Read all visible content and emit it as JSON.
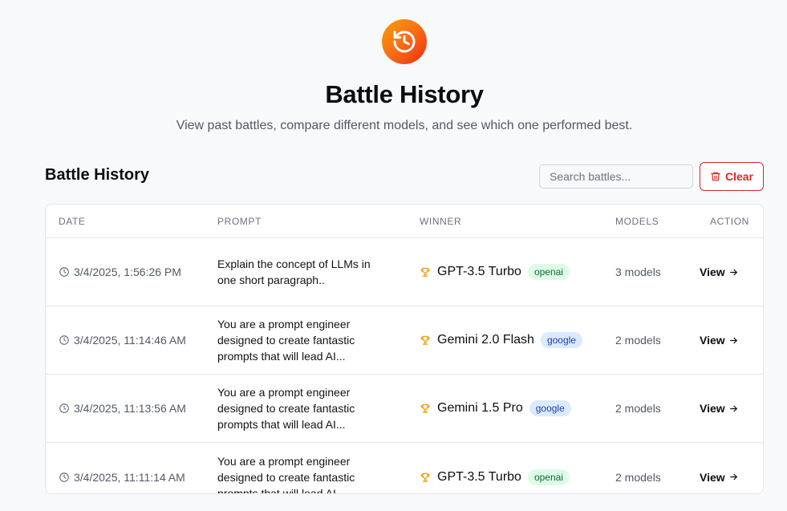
{
  "header": {
    "icon": "history-icon",
    "title": "Battle History",
    "subtitle": "View past battles, compare different models, and see which one performed best."
  },
  "section": {
    "title": "Battle History",
    "search_placeholder": "Search battles...",
    "clear_label": "Clear"
  },
  "table": {
    "columns": [
      "Date",
      "Prompt",
      "Winner",
      "Models",
      "Action"
    ],
    "rows": [
      {
        "date": "3/4/2025, 1:56:26 PM",
        "prompt_lines": [
          "Explain the concept of LLMs in",
          "one short paragraph.."
        ],
        "winner": "GPT-3.5 Turbo",
        "provider": "openai",
        "models": "3 models",
        "action": "View"
      },
      {
        "date": "3/4/2025, 11:14:46 AM",
        "prompt_lines": [
          "You are a prompt engineer",
          "designed to create fantastic",
          "prompts that will lead AI..."
        ],
        "winner": "Gemini 2.0 Flash",
        "provider": "google",
        "models": "2 models",
        "action": "View"
      },
      {
        "date": "3/4/2025, 11:13:56 AM",
        "prompt_lines": [
          "You are a prompt engineer",
          "designed to create fantastic",
          "prompts that will lead AI..."
        ],
        "winner": "Gemini 1.5 Pro",
        "provider": "google",
        "models": "2 models",
        "action": "View"
      },
      {
        "date": "3/4/2025, 11:11:14 AM",
        "prompt_lines": [
          "You are a prompt engineer",
          "designed to create fantastic",
          "prompts that will lead AI..."
        ],
        "winner": "GPT-3.5 Turbo",
        "provider": "openai",
        "models": "2 models",
        "action": "View"
      }
    ]
  },
  "colors": {
    "accent_start": "#f59e0b",
    "accent_end": "#ef2b12",
    "danger": "#dc2626",
    "trophy": "#f59e0b",
    "openai_badge_bg": "#dcfce7",
    "google_badge_bg": "#dbeafe"
  }
}
